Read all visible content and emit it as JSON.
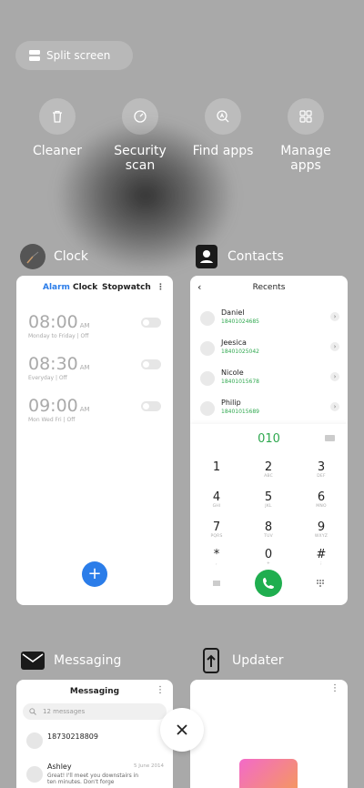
{
  "split_screen": {
    "label": "Split screen"
  },
  "tools": [
    {
      "label": "Cleaner",
      "icon": "trash-icon"
    },
    {
      "label": "Security\nscan",
      "icon": "shield-scan-icon"
    },
    {
      "label": "Find apps",
      "icon": "search-app-icon"
    },
    {
      "label": "Manage\napps",
      "icon": "grid-icon"
    }
  ],
  "clock": {
    "app_name": "Clock",
    "tabs": [
      "Alarm",
      "Clock",
      "Stopwatch"
    ],
    "alarms": [
      {
        "time": "08:00",
        "ampm": "AM",
        "schedule": "Monday to Friday | Off"
      },
      {
        "time": "08:30",
        "ampm": "AM",
        "schedule": "Everyday | Off"
      },
      {
        "time": "09:00",
        "ampm": "AM",
        "schedule": "Mon Wed Fri | Off"
      }
    ],
    "add_label": "+"
  },
  "contacts": {
    "app_name": "Contacts",
    "title": "Recents",
    "entries": [
      {
        "name": "Daniel",
        "number": "18401024685"
      },
      {
        "name": "Jeesica",
        "number": "18401025042"
      },
      {
        "name": "Nicole",
        "number": "18401015678"
      },
      {
        "name": "Philip",
        "number": "18401015689"
      }
    ],
    "dialed": "010",
    "keys": [
      {
        "n": "1",
        "l": ""
      },
      {
        "n": "2",
        "l": "ABC"
      },
      {
        "n": "3",
        "l": "DEF"
      },
      {
        "n": "4",
        "l": "GHI"
      },
      {
        "n": "5",
        "l": "JKL"
      },
      {
        "n": "6",
        "l": "MNO"
      },
      {
        "n": "7",
        "l": "PQRS"
      },
      {
        "n": "8",
        "l": "TUV"
      },
      {
        "n": "9",
        "l": "WXYZ"
      },
      {
        "n": "*",
        "l": ","
      },
      {
        "n": "0",
        "l": "+"
      },
      {
        "n": "#",
        "l": ";"
      }
    ]
  },
  "messaging": {
    "app_name": "Messaging",
    "title": "Messaging",
    "search_placeholder": "12 messages",
    "threads": [
      {
        "name": "18730218809",
        "text": "",
        "date": ""
      },
      {
        "name": "Ashley",
        "text": "Great! I'll meet you downstairs in ten minutes. Don't forge",
        "date": "5 June 2014"
      }
    ]
  },
  "updater": {
    "app_name": "Updater"
  },
  "colors": {
    "accent_green": "#1fae4f",
    "accent_blue": "#2b7de9",
    "background": "#a9a9a9"
  }
}
